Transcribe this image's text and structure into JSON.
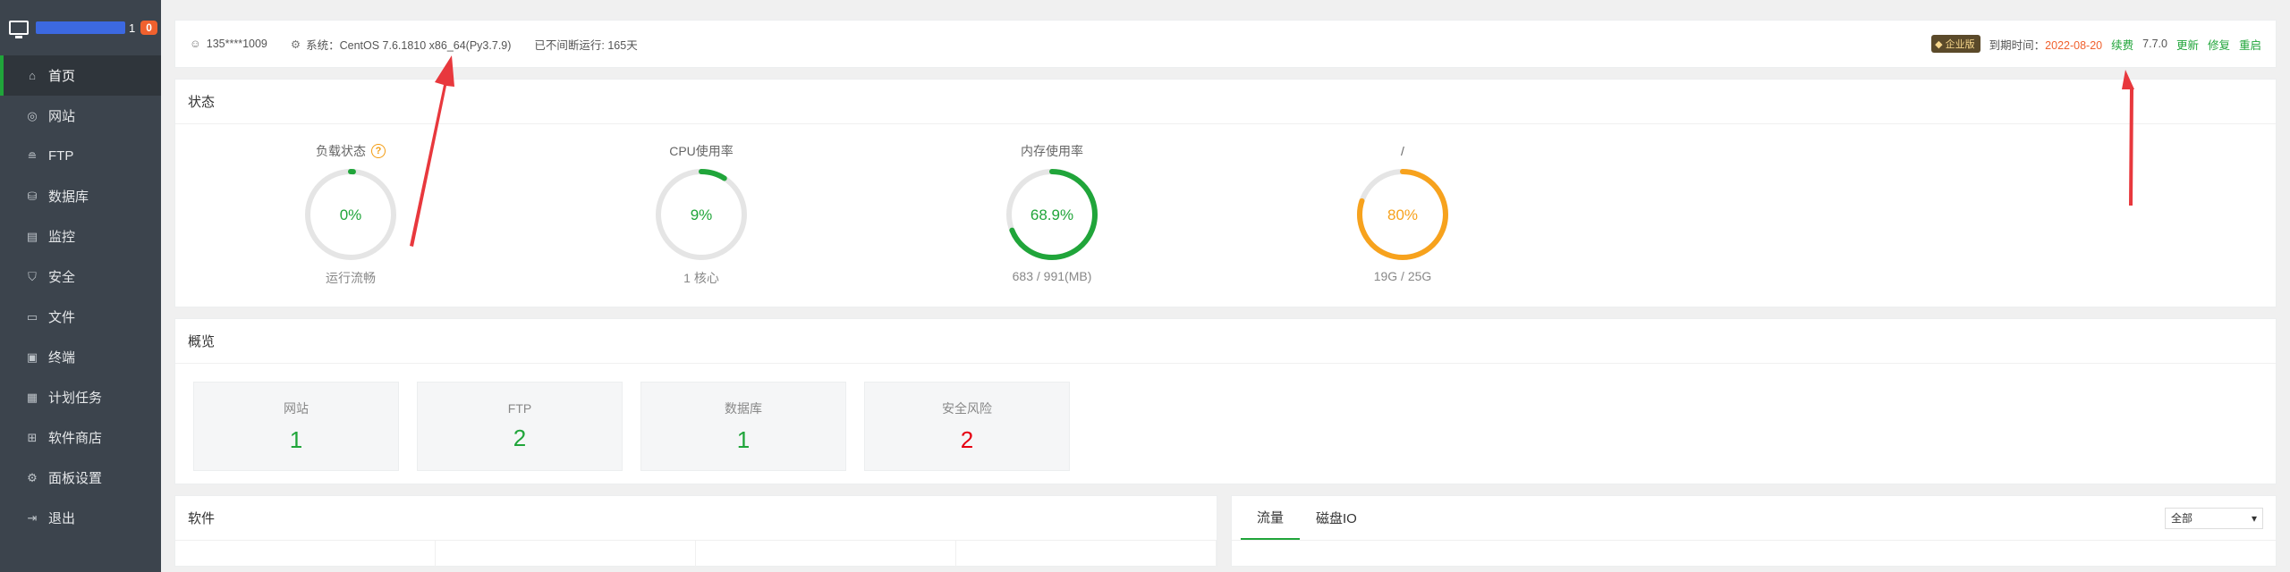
{
  "sidebar": {
    "badge_count": "0",
    "ip_tail": "1",
    "items": [
      {
        "label": "首页",
        "icon": "home-icon"
      },
      {
        "label": "网站",
        "icon": "globe-icon"
      },
      {
        "label": "FTP",
        "icon": "ftp-icon"
      },
      {
        "label": "数据库",
        "icon": "database-icon"
      },
      {
        "label": "监控",
        "icon": "monitor-icon"
      },
      {
        "label": "安全",
        "icon": "shield-icon"
      },
      {
        "label": "文件",
        "icon": "folder-icon"
      },
      {
        "label": "终端",
        "icon": "terminal-icon"
      },
      {
        "label": "计划任务",
        "icon": "calendar-icon"
      },
      {
        "label": "软件商店",
        "icon": "apps-icon"
      },
      {
        "label": "面板设置",
        "icon": "gear-icon"
      },
      {
        "label": "退出",
        "icon": "logout-icon"
      }
    ]
  },
  "topbar": {
    "user": "135****1009",
    "system": "系统：CentOS 7.6.1810 x86_64(Py3.7.9)",
    "uptime": "已不间断运行: 165天",
    "edition": "企业版",
    "expire_label": "到期时间：",
    "expire_date": "2022-08-20",
    "renew": "续费",
    "version": "7.7.0",
    "update": "更新",
    "repair": "修复",
    "restart": "重启"
  },
  "status": {
    "title": "状态",
    "gauges": [
      {
        "label": "负载状态",
        "value": "0%",
        "percent": 0,
        "sub": "运行流畅",
        "color": "#20a53a",
        "help": "?"
      },
      {
        "label": "CPU使用率",
        "value": "9%",
        "percent": 9,
        "sub": "1 核心",
        "color": "#20a53a"
      },
      {
        "label": "内存使用率",
        "value": "68.9%",
        "percent": 68.9,
        "sub": "683 / 991(MB)",
        "color": "#20a53a"
      },
      {
        "label": "/",
        "value": "80%",
        "percent": 80,
        "sub": "19G / 25G",
        "color": "#f7a21d"
      }
    ]
  },
  "overview": {
    "title": "概览",
    "boxes": [
      {
        "title": "网站",
        "value": "1"
      },
      {
        "title": "FTP",
        "value": "2"
      },
      {
        "title": "数据库",
        "value": "1"
      },
      {
        "title": "安全风险",
        "value": "2"
      }
    ]
  },
  "software": {
    "title": "软件"
  },
  "traffic": {
    "tabs": [
      "流量",
      "磁盘IO"
    ],
    "select_value": "全部"
  }
}
